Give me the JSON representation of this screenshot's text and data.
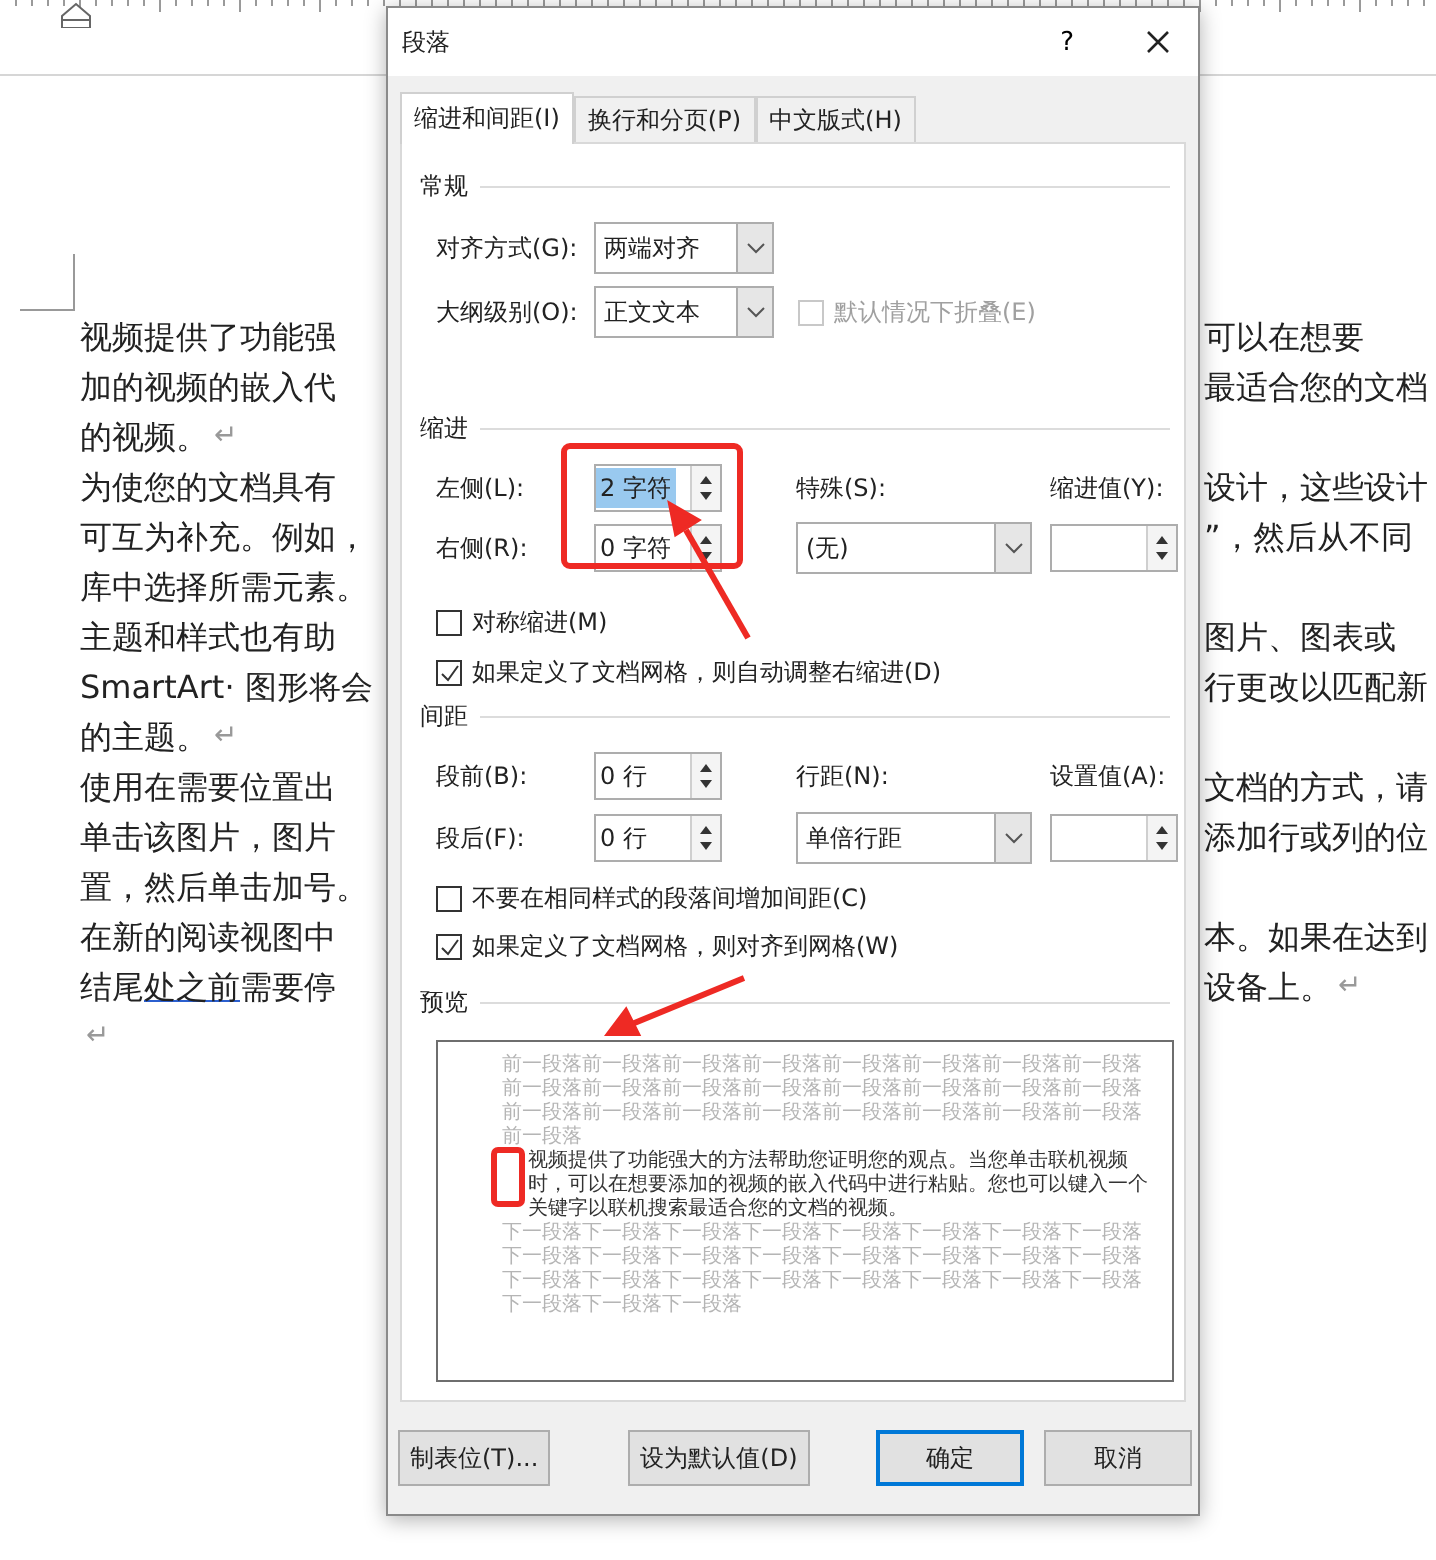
{
  "document": {
    "lines": [
      {
        "left": "视频提供了功能强",
        "right": "可以在想要"
      },
      {
        "left": "加的视频的嵌入代",
        "right": "最适合您的文档"
      },
      {
        "left": "的视频。",
        "left_mark": "↵"
      },
      {
        "left": "为使您的文档具有",
        "right": "设计，这些设计"
      },
      {
        "left": "可互为补充。例如，",
        "right": "”，然后从不同"
      },
      {
        "left": "库中选择所需元素。"
      },
      {
        "left": "主题和样式也有助",
        "right": "图片、图表或"
      },
      {
        "left": "SmartArt· 图形将会",
        "right": "行更改以匹配新"
      },
      {
        "left": "的主题。",
        "left_mark": "↵"
      },
      {
        "left": "使用在需要位置出",
        "right": "文档的方式，请"
      },
      {
        "left": "单击该图片，图片",
        "right": "添加行或列的位"
      },
      {
        "left": "置，然后单击加号。"
      },
      {
        "left": "在新的阅读视图中",
        "right": "本。如果在达到"
      },
      {
        "left_parts": [
          {
            "text": "结尾",
            "underlined": false
          },
          {
            "text": "处之前",
            "underlined": true
          },
          {
            "text": "需要停",
            "underlined": false
          }
        ],
        "right": "设备上。",
        "right_mark": "↵"
      },
      {
        "left_mark": "↵"
      }
    ]
  },
  "dialog": {
    "title": "段落",
    "help": "?",
    "tabs": [
      {
        "label": "缩进和间距(I)",
        "selected": true
      },
      {
        "label": "换行和分页(P)",
        "selected": false
      },
      {
        "label": "中文版式(H)",
        "selected": false
      }
    ],
    "general": {
      "heading": "常规",
      "alignment": {
        "label": "对齐方式(G):",
        "value": "两端对齐"
      },
      "outline": {
        "label": "大纲级别(O):",
        "value": "正文文本"
      },
      "collapse": {
        "label": "默认情况下折叠(E)",
        "checked": false,
        "disabled": true
      }
    },
    "indent": {
      "heading": "缩进",
      "left": {
        "label": "左侧(L):",
        "value": "2 字符",
        "text_selected": true
      },
      "right": {
        "label": "右侧(R):",
        "value": "0 字符",
        "text_selected": false
      },
      "special": {
        "label": "特殊(S):",
        "value": "(无)"
      },
      "by": {
        "label": "缩进值(Y):"
      },
      "checks": [
        {
          "label": "对称缩进(M)",
          "checked": false
        },
        {
          "label": "如果定义了文档网格，则自动调整右缩进(D)",
          "checked": true
        }
      ]
    },
    "spacing": {
      "heading": "间距",
      "before": {
        "label": "段前(B):",
        "value": "0 行"
      },
      "after": {
        "label": "段后(F):",
        "value": "0 行"
      },
      "line": {
        "label": "行距(N):",
        "value": "单倍行距"
      },
      "at": {
        "label": "设置值(A):"
      },
      "checks": [
        {
          "label": "不要在相同样式的段落间增加间距(C)",
          "checked": false
        },
        {
          "label": "如果定义了文档网格，则对齐到网格(W)",
          "checked": true
        }
      ]
    },
    "preview": {
      "heading": "预览",
      "paragraphs": [
        {
          "kind": "previous",
          "text": "前一段落前一段落前一段落前一段落前一段落前一段落前一段落前一段落前一段落前一段落前一段落前一段落前一段落前一段落前一段落前一段落前一段落前一段落前一段落前一段落前一段落前一段落前一段落前一段落前一段落"
        },
        {
          "kind": "current",
          "text": "视频提供了功能强大的方法帮助您证明您的观点。当您单击联机视频时，可以在想要添加的视频的嵌入代码中进行粘贴。您也可以键入一个关键字以联机搜索最适合您的文档的视频。"
        },
        {
          "kind": "next",
          "text": "下一段落下一段落下一段落下一段落下一段落下一段落下一段落下一段落下一段落下一段落下一段落下一段落下一段落下一段落下一段落下一段落下一段落下一段落下一段落下一段落下一段落下一段落下一段落下一段落下一段落下一段落下一段落"
        }
      ]
    },
    "buttons": [
      {
        "label": "制表位(T)...",
        "default": false
      },
      {
        "label": "设为默认值(D)",
        "default": false
      },
      {
        "label": "确定",
        "default": true
      },
      {
        "label": "取消",
        "default": false
      }
    ]
  }
}
